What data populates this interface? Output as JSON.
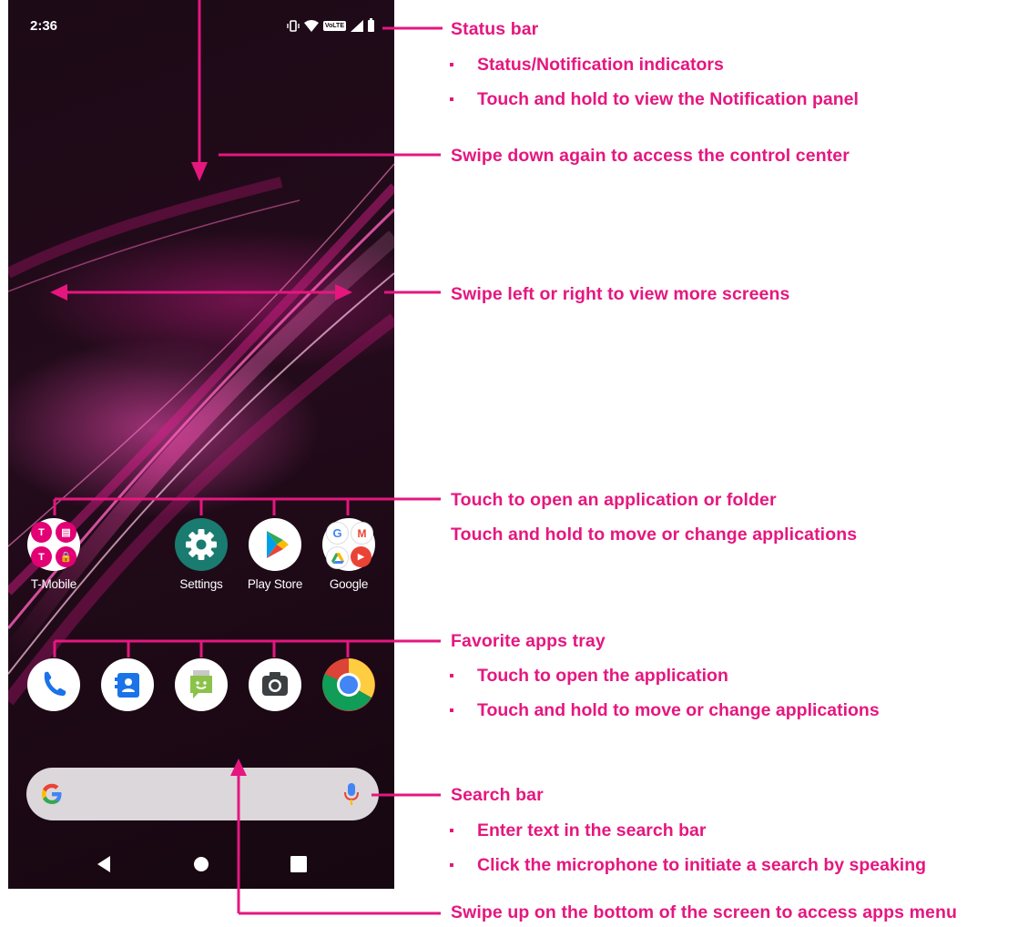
{
  "status_bar": {
    "time": "2:36",
    "network_badge": "VoLTE"
  },
  "home_apps": [
    {
      "label": "T-Mobile",
      "icon": "t-mobile-folder-icon"
    },
    {
      "label": "Settings",
      "icon": "settings-gear-icon"
    },
    {
      "label": "Play Store",
      "icon": "play-store-icon"
    },
    {
      "label": "Google",
      "icon": "google-folder-icon"
    }
  ],
  "dock_apps": [
    {
      "icon": "phone-icon"
    },
    {
      "icon": "contacts-icon"
    },
    {
      "icon": "messages-icon"
    },
    {
      "icon": "camera-icon"
    },
    {
      "icon": "chrome-icon"
    }
  ],
  "annotations": {
    "status_bar": {
      "title": "Status bar",
      "bullets": [
        "Status/Notification indicators",
        "Touch and hold to view the Notification panel"
      ]
    },
    "swipe_down": "Swipe down again to access the control center",
    "swipe_sides": "Swipe left or right to view more screens",
    "apps": {
      "line1": "Touch to open an application or folder",
      "line2": "Touch and hold to move or change applications"
    },
    "favorites": {
      "title": "Favorite apps tray",
      "bullets": [
        "Touch to open the application",
        "Touch and hold to move or change applications"
      ]
    },
    "search": {
      "title": "Search bar",
      "bullets": [
        "Enter text in the search bar",
        "Click the microphone to initiate a search by speaking"
      ]
    },
    "swipe_up": "Swipe up on the bottom of the screen to access apps menu"
  },
  "colors": {
    "accent": "#e5177f",
    "wallpaper": "#1c0a16"
  }
}
